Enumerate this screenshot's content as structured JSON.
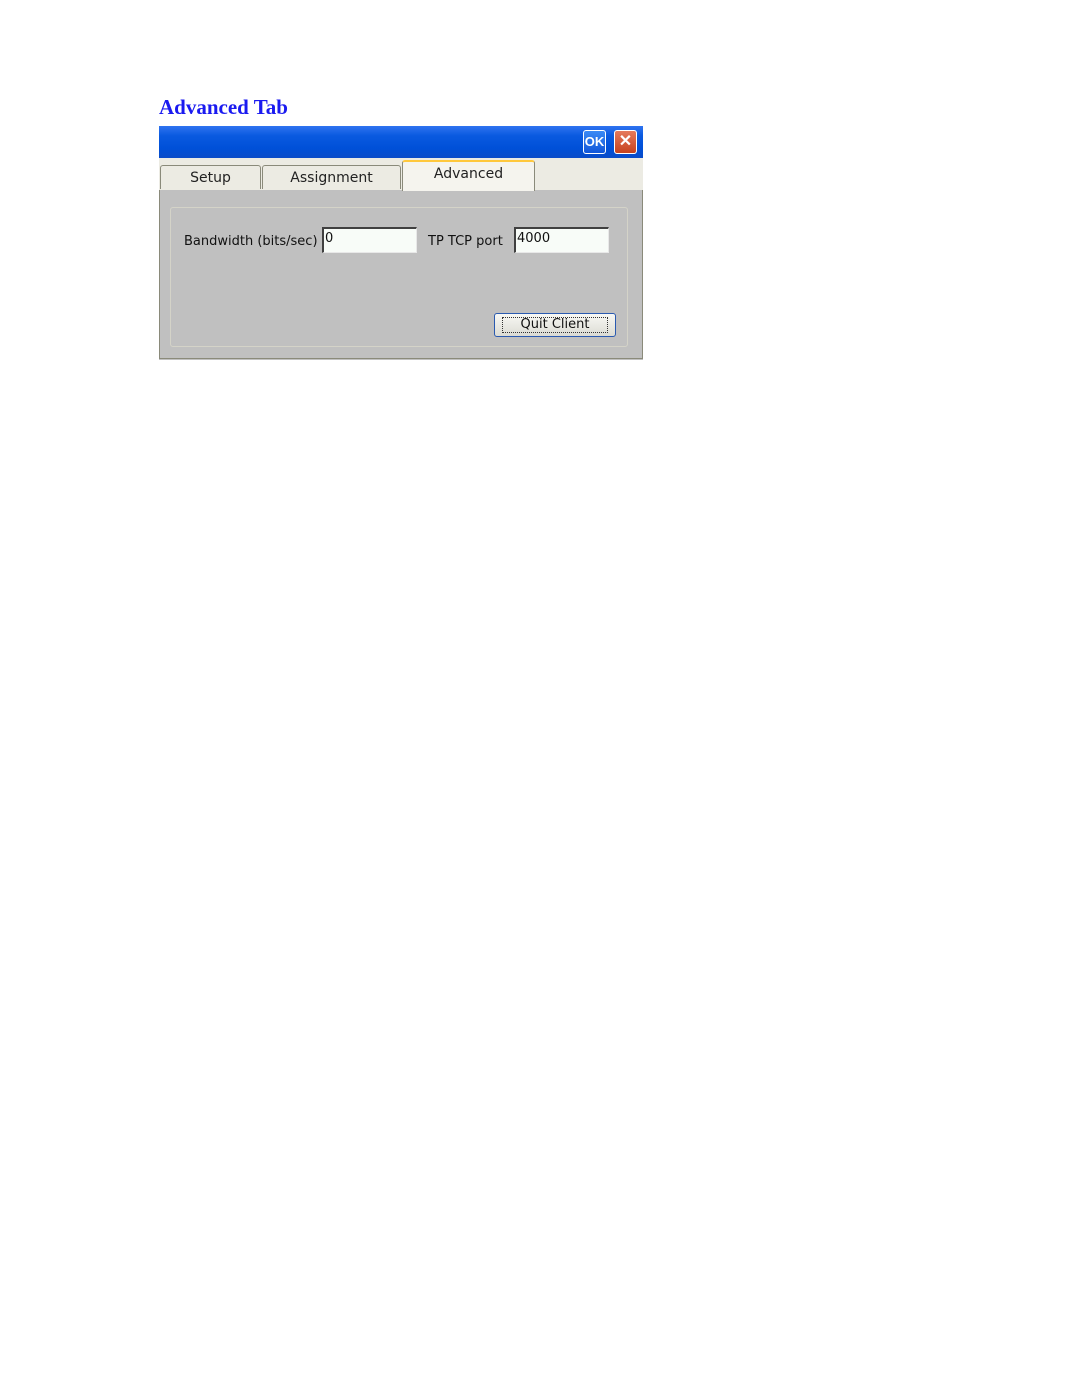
{
  "heading": "Advanced Tab",
  "titlebar": {
    "ok_label": "OK",
    "close_label": "✕"
  },
  "tabs": [
    {
      "label": "Setup",
      "active": false
    },
    {
      "label": "Assignment",
      "active": false
    },
    {
      "label": "Advanced",
      "active": true
    }
  ],
  "fields": {
    "bandwidth_label": "Bandwidth (bits/sec)",
    "bandwidth_value": "0",
    "port_label": "TP TCP port",
    "port_value": "4000"
  },
  "quit_label": "Quit Client"
}
